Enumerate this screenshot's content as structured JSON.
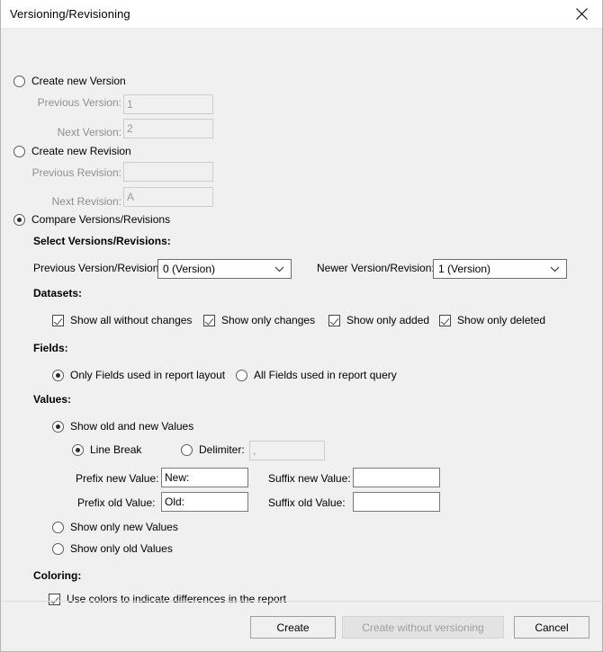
{
  "window": {
    "title": "Versioning/Revisioning",
    "close_icon": "close-icon"
  },
  "options": {
    "create_new_version": {
      "label": "Create new Version",
      "selected": false,
      "previous_label": "Previous Version:",
      "previous_value": "1",
      "next_label": "Next Version:",
      "next_value": "2"
    },
    "create_new_revision": {
      "label": "Create new Revision",
      "selected": false,
      "previous_label": "Previous Revision:",
      "previous_value": "",
      "next_label": "Next Revision:",
      "next_value": "A"
    },
    "compare": {
      "label": "Compare Versions/Revisions",
      "selected": true
    }
  },
  "select_versions": {
    "heading": "Select Versions/Revisions:",
    "previous_label": "Previous Version/Revision:",
    "previous_value": "0 (Version)",
    "newer_label": "Newer Version/Revision:",
    "newer_value": "1 (Version)",
    "arrow_icon": "chevron-down-icon"
  },
  "datasets": {
    "heading": "Datasets:",
    "items": [
      {
        "label": "Show all without changes",
        "checked": true
      },
      {
        "label": "Show only changes",
        "checked": true
      },
      {
        "label": "Show only added",
        "checked": true
      },
      {
        "label": "Show only deleted",
        "checked": true
      }
    ]
  },
  "fields": {
    "heading": "Fields:",
    "options": [
      {
        "label": "Only Fields used in report layout",
        "selected": true
      },
      {
        "label": "All Fields used in report query",
        "selected": false
      }
    ]
  },
  "values": {
    "heading": "Values:",
    "show_old_and_new": {
      "label": "Show old and new Values",
      "selected": true
    },
    "line_break": {
      "label": "Line Break",
      "selected": true
    },
    "delimiter": {
      "label": "Delimiter:",
      "selected": false,
      "value": ","
    },
    "prefix_new_label": "Prefix new Value:",
    "prefix_new_value": "New:",
    "suffix_new_label": "Suffix new Value:",
    "suffix_new_value": "",
    "prefix_old_label": "Prefix old Value:",
    "prefix_old_value": "Old:",
    "suffix_old_label": "Suffix old Value:",
    "suffix_old_value": "",
    "show_only_new": {
      "label": "Show only new Values",
      "selected": false
    },
    "show_only_old": {
      "label": "Show only old Values",
      "selected": false
    }
  },
  "coloring": {
    "heading": "Coloring:",
    "use_colors": {
      "label": "Use colors to indicate differences in the report",
      "checked": true
    }
  },
  "footer": {
    "create_label": "Create",
    "create_without_versioning_label": "Create without versioning",
    "cancel_label": "Cancel"
  }
}
